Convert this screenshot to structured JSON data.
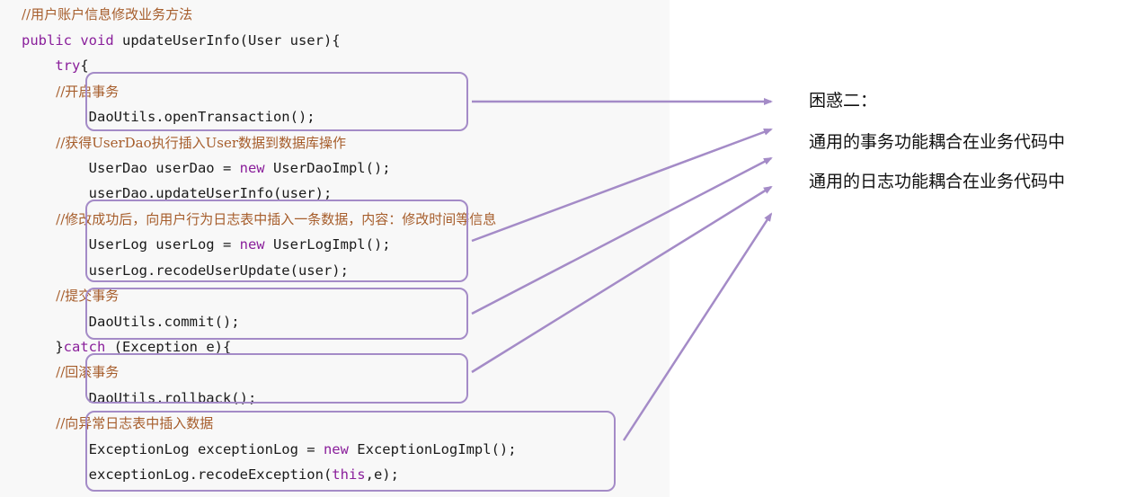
{
  "code": {
    "lines": [
      [
        {
          "t": "//用户账户信息修改业务方法",
          "c": "cm"
        }
      ],
      [
        {
          "t": "public void ",
          "c": "kw"
        },
        {
          "t": "updateUserInfo(User user){",
          "c": "plain"
        }
      ],
      [
        {
          "t": "    try",
          "c": "kw"
        },
        {
          "t": "{",
          "c": "plain"
        }
      ],
      [
        {
          "t": "        //开启事务",
          "c": "cm"
        }
      ],
      [
        {
          "t": "        DaoUtils.openTransaction();",
          "c": "plain"
        }
      ],
      [
        {
          "t": "        //获得UserDao执行插入User数据到数据库操作",
          "c": "cm"
        }
      ],
      [
        {
          "t": "        UserDao userDao = ",
          "c": "plain"
        },
        {
          "t": "new ",
          "c": "kw"
        },
        {
          "t": "UserDaoImpl();",
          "c": "plain"
        }
      ],
      [
        {
          "t": "        userDao.updateUserInfo(user);",
          "c": "plain"
        }
      ],
      [
        {
          "t": "        //修改成功后，向用户行为日志表中插入一条数据，内容：修改时间等信息",
          "c": "cm"
        }
      ],
      [
        {
          "t": "        UserLog userLog = ",
          "c": "plain"
        },
        {
          "t": "new ",
          "c": "kw"
        },
        {
          "t": "UserLogImpl();",
          "c": "plain"
        }
      ],
      [
        {
          "t": "        userLog.recodeUserUpdate(user);",
          "c": "plain"
        }
      ],
      [
        {
          "t": "        //提交事务",
          "c": "cm"
        }
      ],
      [
        {
          "t": "        DaoUtils.commit();",
          "c": "plain"
        }
      ],
      [
        {
          "t": "    }",
          "c": "plain"
        },
        {
          "t": "catch ",
          "c": "kw"
        },
        {
          "t": "(Exception e){",
          "c": "plain"
        }
      ],
      [
        {
          "t": "        //回滚事务",
          "c": "cm"
        }
      ],
      [
        {
          "t": "        DaoUtils.rollback();",
          "c": "plain"
        }
      ],
      [
        {
          "t": "        //向异常日志表中插入数据",
          "c": "cm"
        }
      ],
      [
        {
          "t": "        ExceptionLog exceptionLog = ",
          "c": "plain"
        },
        {
          "t": "new ",
          "c": "kw"
        },
        {
          "t": "ExceptionLogImpl();",
          "c": "plain"
        }
      ],
      [
        {
          "t": "        exceptionLog.recodeException(",
          "c": "plain"
        },
        {
          "t": "this",
          "c": "kw"
        },
        {
          "t": ",e);",
          "c": "plain"
        }
      ]
    ]
  },
  "confusion": {
    "title": "困惑二：",
    "items": [
      "通用的事务功能耦合在业务代码中",
      "通用的日志功能耦合在业务代码中"
    ]
  },
  "colors": {
    "box_border": "#a48bc7",
    "arrow": "#a48bc7",
    "comment": "#a65d2b",
    "keyword": "#8a1f9b"
  }
}
